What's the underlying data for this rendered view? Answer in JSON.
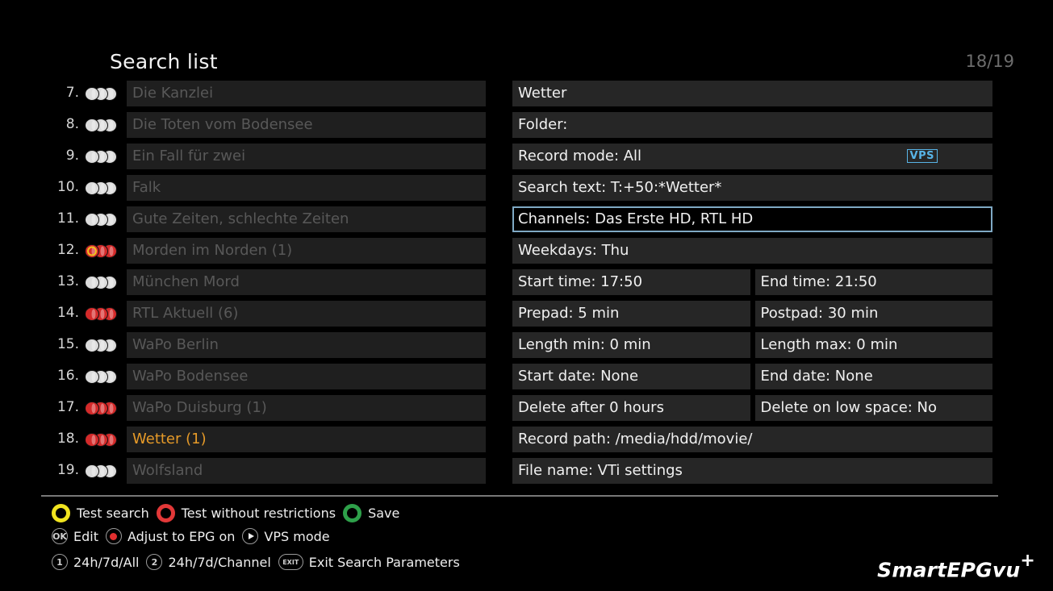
{
  "header": {
    "title": "Search list",
    "counter": "18/19"
  },
  "list": [
    {
      "num": "7.",
      "name": "Die Kanzlei",
      "status": "off"
    },
    {
      "num": "8.",
      "name": "Die Toten vom Bodensee",
      "status": "off"
    },
    {
      "num": "9.",
      "name": "Ein Fall für zwei",
      "status": "off"
    },
    {
      "num": "10.",
      "name": "Falk",
      "status": "off"
    },
    {
      "num": "11.",
      "name": "Gute Zeiten, schlechte Zeiten",
      "status": "off"
    },
    {
      "num": "12.",
      "name": "Morden im Norden (1)",
      "status": "partial"
    },
    {
      "num": "13.",
      "name": "München Mord",
      "status": "off"
    },
    {
      "num": "14.",
      "name": "RTL Aktuell (6)",
      "status": "on"
    },
    {
      "num": "15.",
      "name": "WaPo Berlin",
      "status": "off"
    },
    {
      "num": "16.",
      "name": "WaPo Bodensee",
      "status": "off"
    },
    {
      "num": "17.",
      "name": "WaPo Duisburg (1)",
      "status": "on"
    },
    {
      "num": "18.",
      "name": "Wetter (1)",
      "status": "on",
      "active": true
    },
    {
      "num": "19.",
      "name": "Wolfsland",
      "status": "off"
    }
  ],
  "details": [
    [
      "Wetter"
    ],
    [
      "Folder:"
    ],
    [
      "Record mode: All"
    ],
    [
      "Search text: T:+50:*Wetter*"
    ],
    [
      "Channels: Das Erste HD, RTL HD"
    ],
    [
      "Weekdays:  Thu"
    ],
    [
      "Start time: 17:50",
      "End time: 21:50"
    ],
    [
      "Prepad: 5 min",
      "Postpad: 30 min"
    ],
    [
      "Length min: 0 min",
      "Length max: 0 min"
    ],
    [
      "Start date: None",
      "End date: None"
    ],
    [
      "Delete after 0 hours",
      "Delete on low space: No"
    ],
    [
      "Record path: /media/hdd/movie/"
    ],
    [
      "File name: VTi settings"
    ]
  ],
  "selected_detail": 4,
  "vps_badge": "VPS",
  "hints": {
    "yellow": "Test search",
    "red": "Test without restrictions",
    "green": "Save",
    "ok_key": "OK",
    "ok": "Edit",
    "rec": "Adjust to EPG on",
    "play": "VPS mode",
    "key1": "1",
    "one": "24h/7d/All",
    "key2": "2",
    "two": "24h/7d/Channel",
    "exit_key": "EXIT",
    "exit": "Exit Search Parameters"
  },
  "logo": {
    "text": "SmartEPGvu",
    "sup": "+"
  },
  "colors": {
    "active": "#e69a28",
    "selection_border": "#7fa9c4",
    "vps": "#58b4e6",
    "on_red": "#d42a2a",
    "off_grey": "#dcdcdc"
  }
}
